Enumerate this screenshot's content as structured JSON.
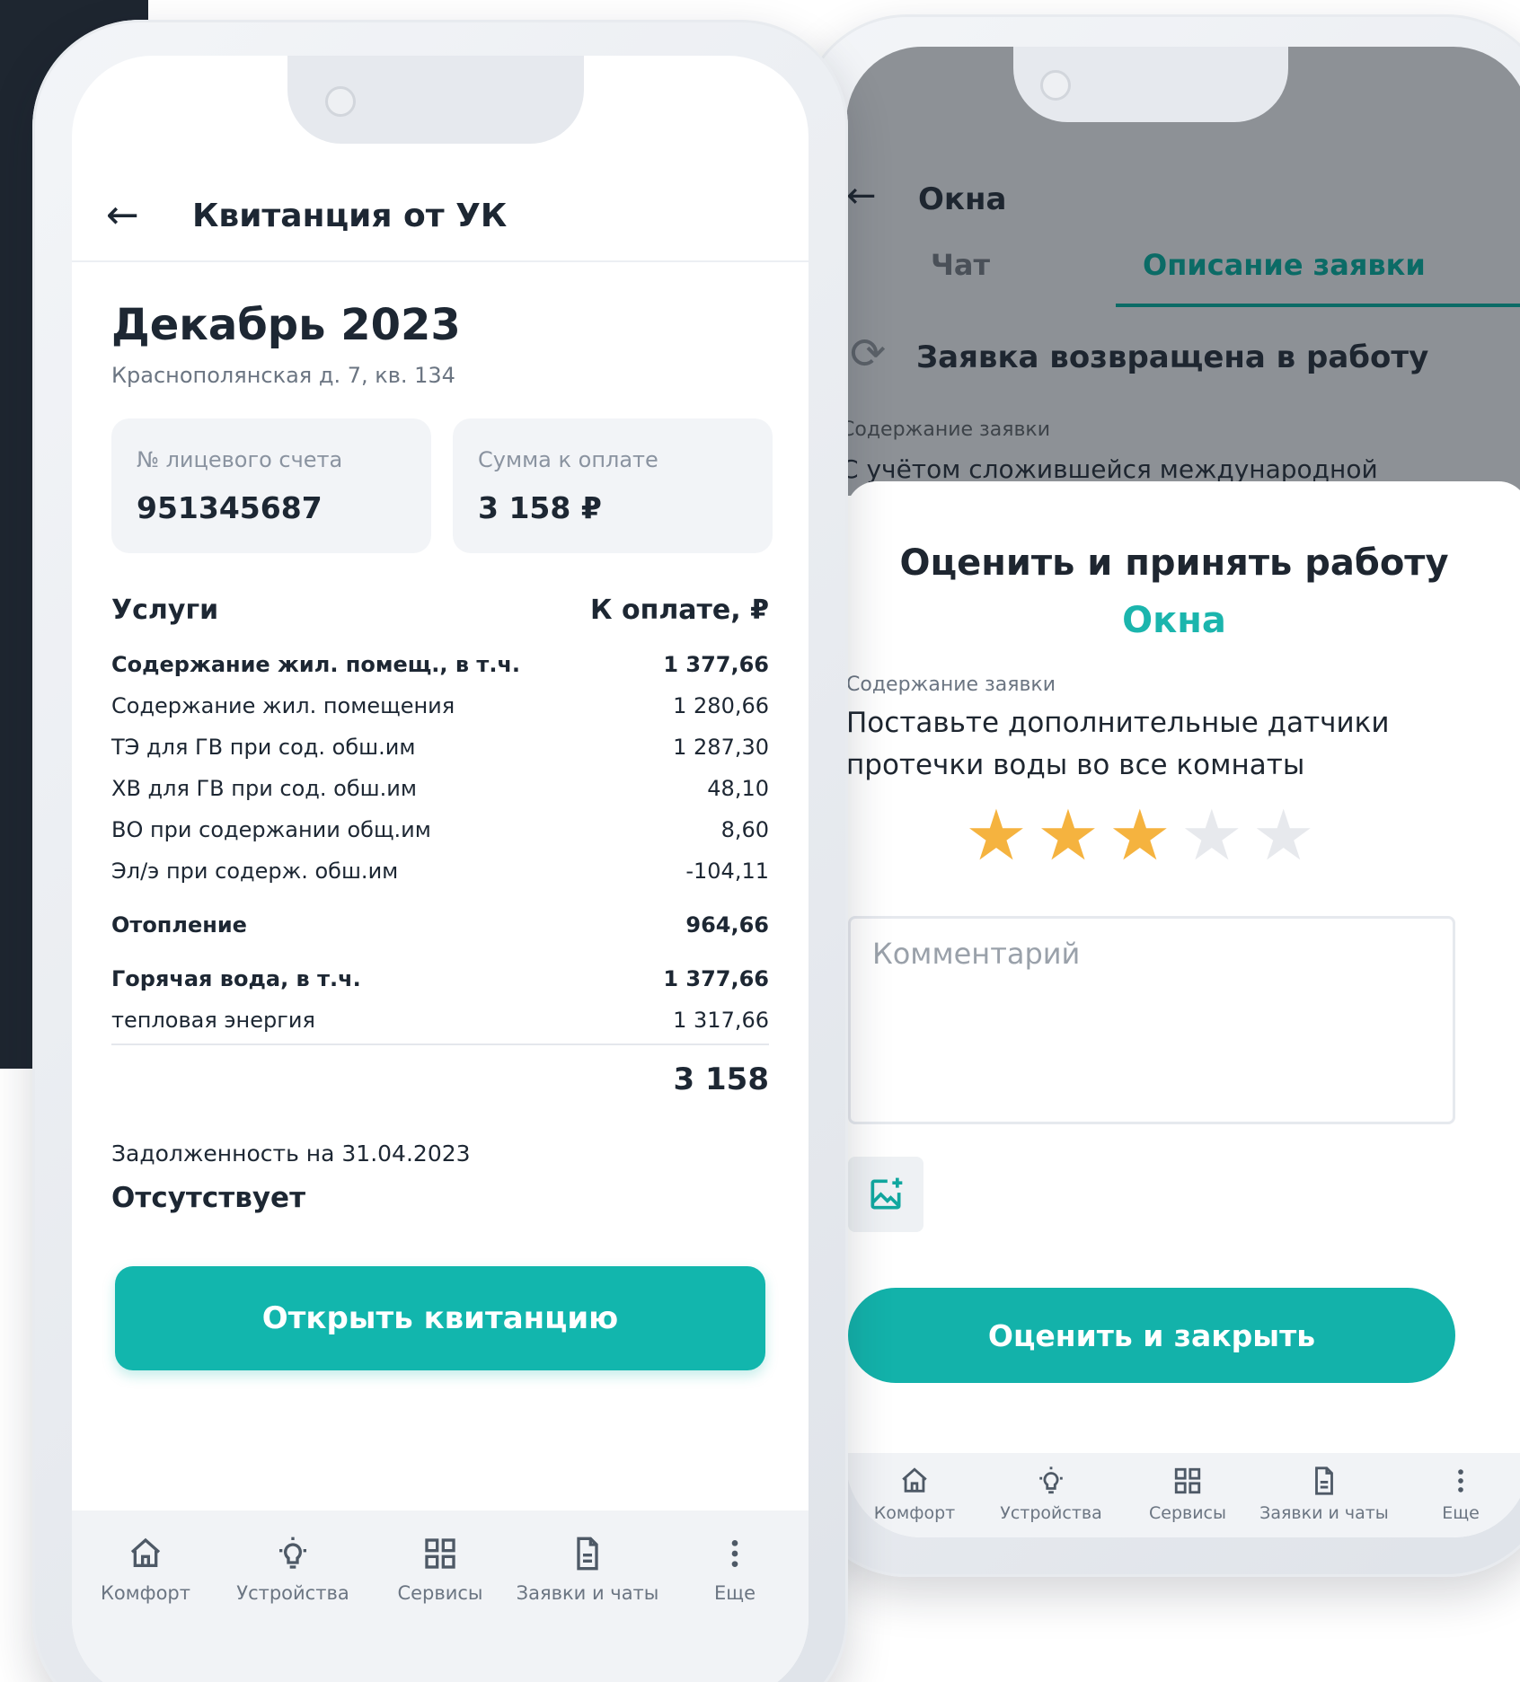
{
  "left_phone": {
    "header": {
      "back_icon": "arrow-left-icon",
      "title": "Квитанция от УК"
    },
    "month": "Декабрь 2023",
    "address": "Краснополянская д. 7, кв. 134",
    "account_card": {
      "label": "№ лицевого счета",
      "value": "951345687"
    },
    "amount_card": {
      "label": "Сумма к оплате",
      "value": "3 158 ₽"
    },
    "table": {
      "col_service": "Услуги",
      "col_amount": "К оплате, ₽",
      "rows": [
        {
          "label": "Содержание жил. помещ., в т.ч.",
          "value": "1 377,66",
          "bold": true
        },
        {
          "label": "Содержание жил. помещения",
          "value": "1 280,66",
          "bold": false
        },
        {
          "label": "ТЭ для ГВ при сод. обш.им",
          "value": "1 287,30",
          "bold": false
        },
        {
          "label": "ХВ для ГВ при сод. обш.им",
          "value": "48,10",
          "bold": false
        },
        {
          "label": "ВО при содержании общ.им",
          "value": "8,60",
          "bold": false
        },
        {
          "label": "Эл/э при содерж. обш.им",
          "value": "-104,11",
          "bold": false
        },
        {
          "label": "Отопление",
          "value": "964,66",
          "bold": true
        },
        {
          "label": "Горячая вода, в т.ч.",
          "value": "1 377,66",
          "bold": true
        },
        {
          "label": "тепловая энергия",
          "value": "1 317,66",
          "bold": false
        }
      ],
      "total": "3 158"
    },
    "debt": {
      "label": "Задолженность на 31.04.2023",
      "value": "Отсутствует"
    },
    "open_button": "Открыть квитанцию"
  },
  "right_phone": {
    "header": {
      "back_icon": "arrow-left-icon",
      "title": "Окна"
    },
    "tabs": [
      {
        "label": "Чат",
        "active": false
      },
      {
        "label": "Описание заявки",
        "active": true
      }
    ],
    "status": {
      "icon": "refresh-icon",
      "text": "Заявка возвращена в работу"
    },
    "content_label": "Содержание заявки",
    "content_preview": "С учётом сложившейся международной",
    "sheet": {
      "title": "Оценить и принять работу",
      "subtitle": "Окна",
      "content_label": "Содержание заявки",
      "content_text": "Поставьте дополнительные датчики протечки воды во все комнаты",
      "rating": 3,
      "rating_max": 5,
      "comment_placeholder": "Комментарий",
      "add_photo_icon": "add-photo-icon",
      "submit_button": "Оценить и закрыть"
    }
  },
  "navbar": {
    "items": [
      {
        "label": "Комфорт",
        "icon": "home-icon"
      },
      {
        "label": "Устройства",
        "icon": "lightbulb-icon"
      },
      {
        "label": "Сервисы",
        "icon": "grid-icon"
      },
      {
        "label": "Заявки и чаты",
        "icon": "document-icon"
      },
      {
        "label": "Еще",
        "icon": "more-icon"
      }
    ]
  },
  "colors": {
    "accent": "#12b6ad",
    "accent_dark": "#0b6b66",
    "star_on": "#f5b33f",
    "star_off": "#e7e9ed",
    "text": "#1d2733",
    "dark_block": "#1e2630"
  }
}
